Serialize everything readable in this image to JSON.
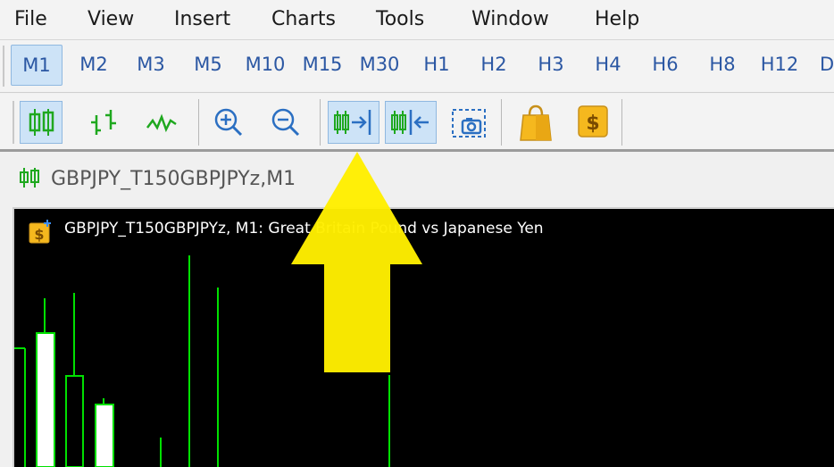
{
  "menu": [
    "File",
    "View",
    "Insert",
    "Charts",
    "Tools",
    "Window",
    "Help"
  ],
  "timeframes": [
    "M1",
    "M2",
    "M3",
    "M5",
    "M10",
    "M15",
    "M30",
    "H1",
    "H2",
    "H3",
    "H4",
    "H6",
    "H8",
    "H12",
    "D"
  ],
  "active_timeframe": "M1",
  "chart_tab": {
    "label": "GBPJPY_T150GBPJPYz,M1"
  },
  "chart": {
    "title": "GBPJPY_T150GBPJPYz, M1:  Great Britain Pound vs Japanese Yen"
  },
  "colors": {
    "bull": "#00e000",
    "candle_fill": "#ffffff",
    "accent": "#2b57a3",
    "arrow": "#ffee00"
  }
}
